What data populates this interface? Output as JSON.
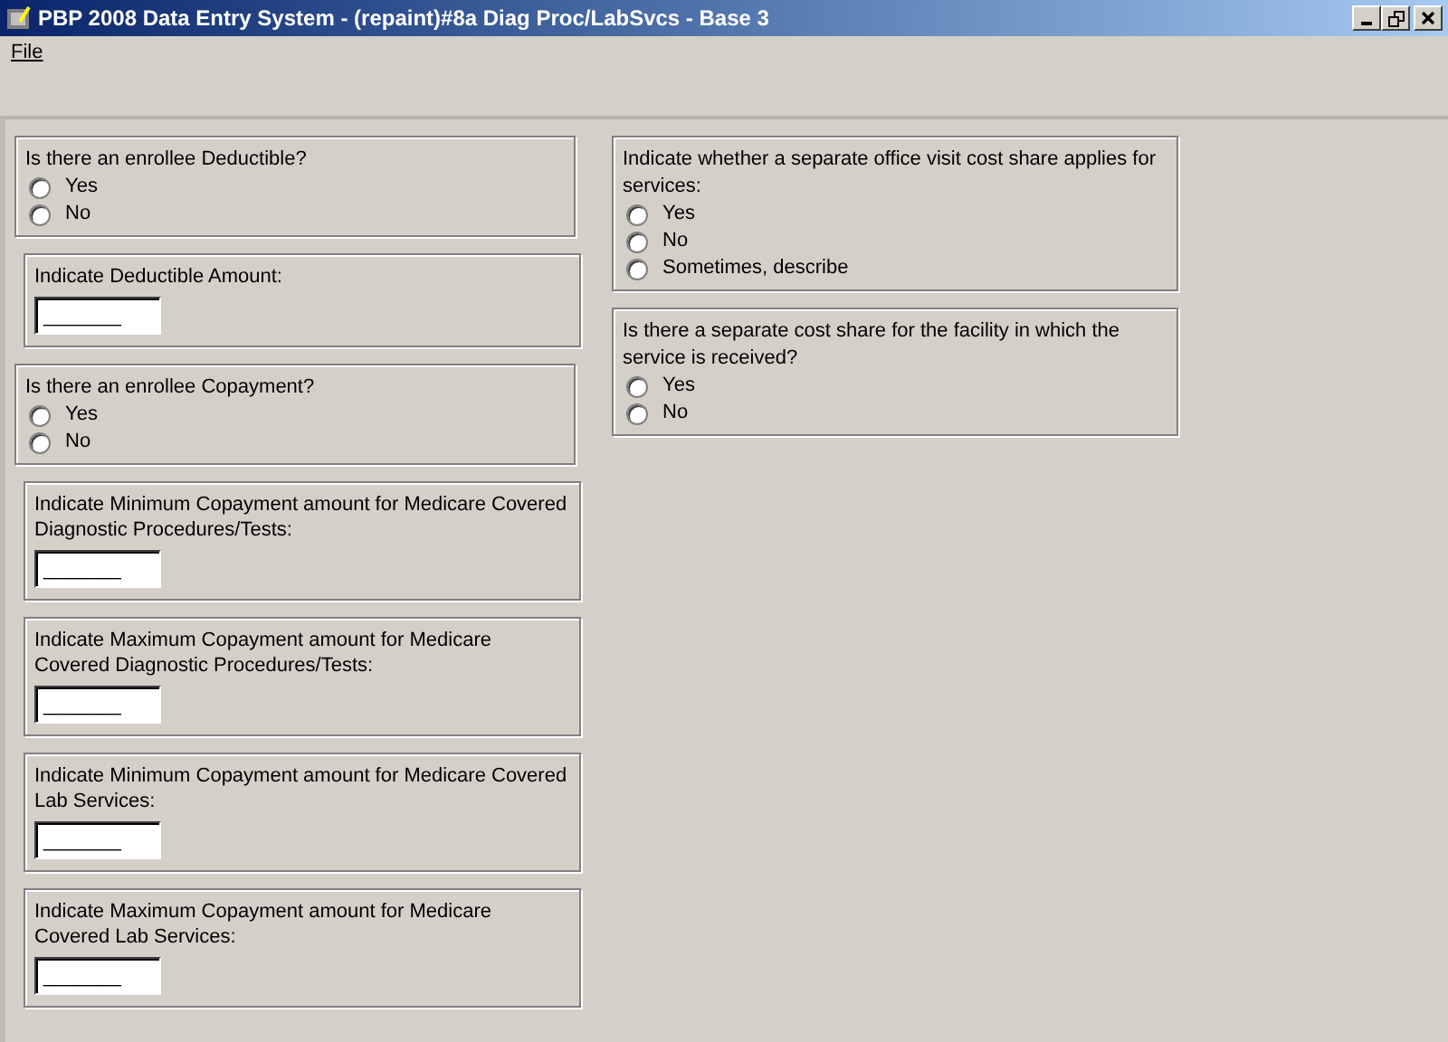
{
  "window": {
    "title": "PBP 2008 Data Entry System - (repaint)#8a Diag Proc/LabSvcs - Base 3"
  },
  "menu": [
    "File"
  ],
  "left_panels": [
    {
      "kind": "radio",
      "question": "Is there an enrollee Deductible?",
      "options": [
        {
          "label": "Yes",
          "selected": false
        },
        {
          "label": "No",
          "selected": false
        }
      ]
    },
    {
      "kind": "amount",
      "question": "Indicate Deductible Amount:",
      "value": "_______"
    },
    {
      "kind": "radio",
      "question": "Is there an enrollee Copayment?",
      "options": [
        {
          "label": "Yes",
          "selected": false
        },
        {
          "label": "No",
          "selected": false
        }
      ]
    },
    {
      "kind": "amount",
      "question": "Indicate Minimum Copayment amount for Medicare Covered Diagnostic Procedures/Tests:",
      "value": "_______"
    },
    {
      "kind": "amount",
      "question": "Indicate Maximum Copayment amount for Medicare Covered Diagnostic Procedures/Tests:",
      "value": "_______"
    },
    {
      "kind": "amount",
      "question": "Indicate Minimum Copayment amount for Medicare Covered Lab Services:",
      "value": "_______"
    },
    {
      "kind": "amount",
      "question": "Indicate Maximum Copayment amount for Medicare Covered Lab Services:",
      "value": "_______"
    }
  ],
  "right_panels": [
    {
      "kind": "radio",
      "question": "Indicate whether a separate office visit cost share applies for services:",
      "options": [
        {
          "label": "Yes",
          "selected": false
        },
        {
          "label": "No",
          "selected": false
        },
        {
          "label": "Sometimes, describe",
          "selected": false
        }
      ]
    },
    {
      "kind": "radio",
      "question": "Is there a separate cost share for the facility in which the service is received?",
      "options": [
        {
          "label": "Yes",
          "selected": false
        },
        {
          "label": "No",
          "selected": false
        }
      ]
    }
  ]
}
